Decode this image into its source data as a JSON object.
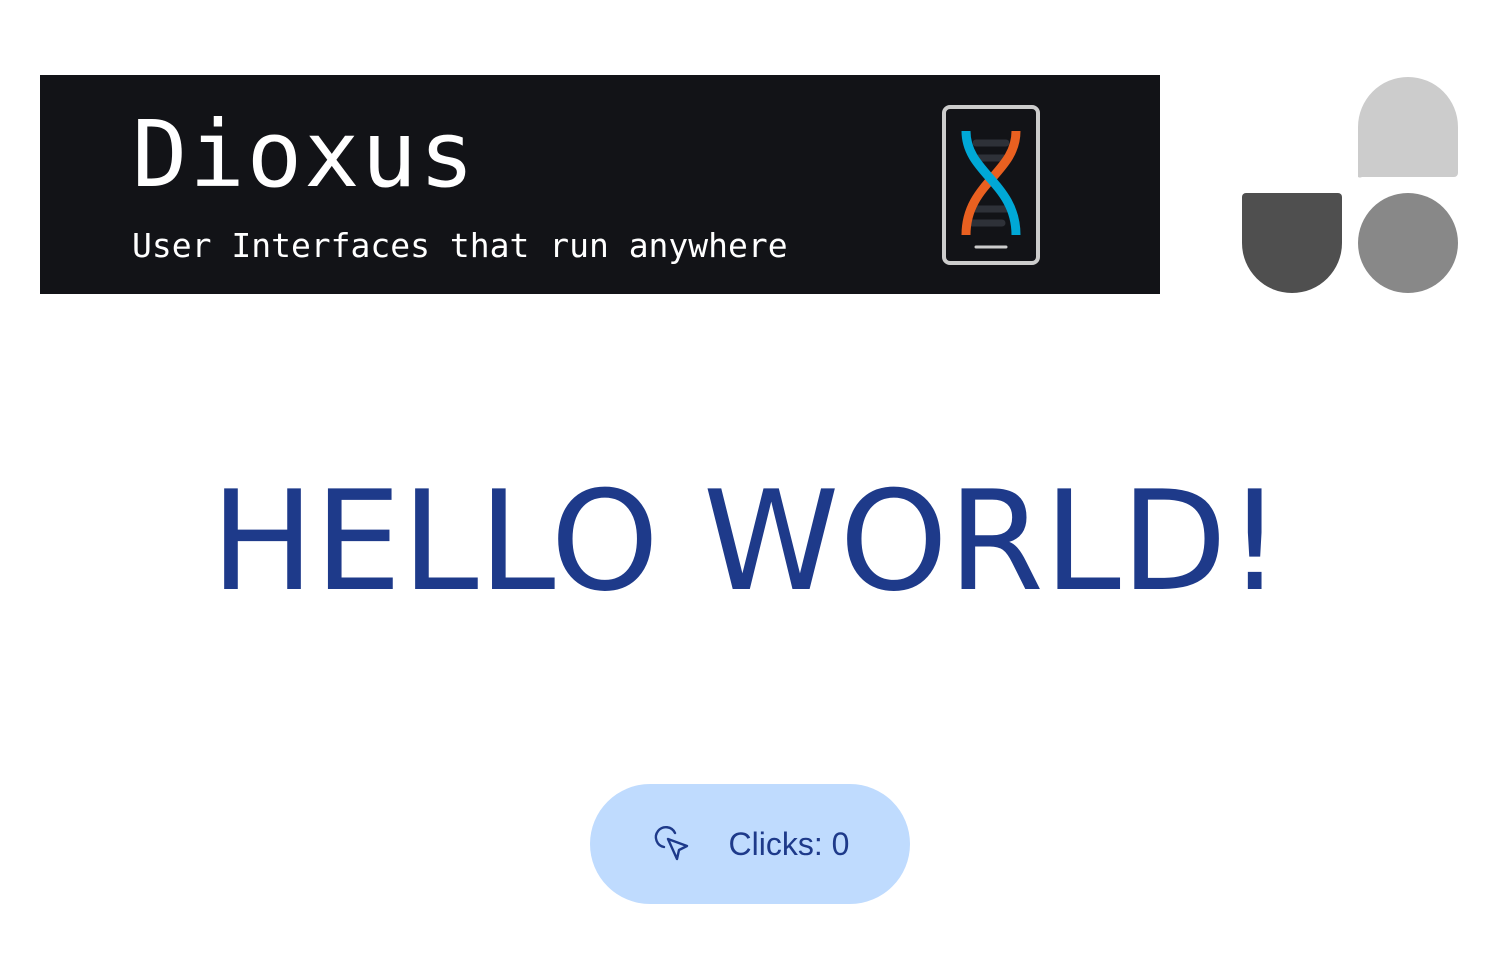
{
  "banner": {
    "title": "Dioxus",
    "subtitle": "User Interfaces that run anywhere",
    "background_color": "#121317",
    "logo_icon": "dna-phone-icon",
    "logo_colors": {
      "blue": "#00a8d6",
      "orange": "#e96020",
      "frame": "#cccccc"
    }
  },
  "corner_logo": {
    "icon": "three-shapes-logo",
    "colors": [
      "#cccccc",
      "#4f4f4f",
      "#888888"
    ]
  },
  "main": {
    "heading": "HELLO WORLD!",
    "heading_color": "#1e3a8a"
  },
  "counter": {
    "label": "Clicks: 0",
    "icon": "pointer-click-icon",
    "button_color": "#bfdbfe",
    "text_color": "#1e3a8a"
  }
}
